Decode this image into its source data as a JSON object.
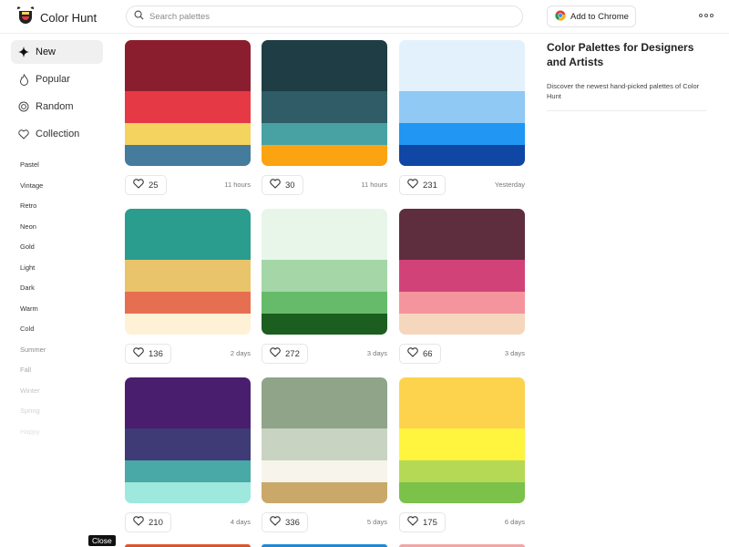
{
  "header": {
    "logo_text": "Color Hunt",
    "search_placeholder": "Search palettes",
    "chrome_button_label": "Add to Chrome"
  },
  "sidebar": {
    "nav": [
      {
        "label": "New",
        "icon": "sparkle-icon",
        "active": true
      },
      {
        "label": "Popular",
        "icon": "flame-icon",
        "active": false
      },
      {
        "label": "Random",
        "icon": "random-icon",
        "active": false
      },
      {
        "label": "Collection",
        "icon": "heart-icon",
        "active": false
      }
    ],
    "tags": [
      "Pastel",
      "Vintage",
      "Retro",
      "Neon",
      "Gold",
      "Light",
      "Dark",
      "Warm",
      "Cold",
      "Summer",
      "Fall",
      "Winter",
      "Spring",
      "Happy"
    ],
    "tag_colors": [
      "#333333",
      "#333333",
      "#333333",
      "#333333",
      "#333333",
      "#333333",
      "#333333",
      "#333333",
      "#444444",
      "#8a8a8a",
      "#aaaaaa",
      "#c4c4c4",
      "#d4d4d4",
      "#e2e2e2"
    ]
  },
  "palettes": [
    {
      "colors": [
        "#8B1E2E",
        "#E63946",
        "#F4D35E",
        "#457B9D"
      ],
      "likes": "25",
      "time": "11 hours"
    },
    {
      "colors": [
        "#1F3D44",
        "#2F5C66",
        "#48A2A3",
        "#FCA311"
      ],
      "likes": "30",
      "time": "11 hours"
    },
    {
      "colors": [
        "#E3F1FC",
        "#90C9F4",
        "#2196F3",
        "#1046A4"
      ],
      "likes": "231",
      "time": "Yesterday"
    },
    {
      "colors": [
        "#2A9D8F",
        "#E9C46A",
        "#E76F51",
        "#FFF1D6"
      ],
      "likes": "136",
      "time": "2 days"
    },
    {
      "colors": [
        "#E8F5E9",
        "#A5D6A7",
        "#66BB6A",
        "#1B5E20"
      ],
      "likes": "272",
      "time": "3 days"
    },
    {
      "colors": [
        "#5E2E3E",
        "#D14378",
        "#F4959D",
        "#F5D7BD"
      ],
      "likes": "66",
      "time": "3 days"
    },
    {
      "colors": [
        "#4A1E6E",
        "#3E3B77",
        "#48A9A6",
        "#9EE8DE"
      ],
      "likes": "210",
      "time": "4 days"
    },
    {
      "colors": [
        "#8FA488",
        "#C9D3C2",
        "#F7F4EC",
        "#C9A86A"
      ],
      "likes": "336",
      "time": "5 days"
    },
    {
      "colors": [
        "#FDD24C",
        "#FFF43E",
        "#B5D955",
        "#7CC14A"
      ],
      "likes": "175",
      "time": "6 days"
    }
  ],
  "next_row_colors": [
    "#D9552B",
    "#1E88D6",
    "#F2A5A5"
  ],
  "right_panel": {
    "title": "Color Palettes for Designers and Artists",
    "description": "Discover the newest hand-picked palettes of Color Hunt"
  },
  "close_label": "Close"
}
